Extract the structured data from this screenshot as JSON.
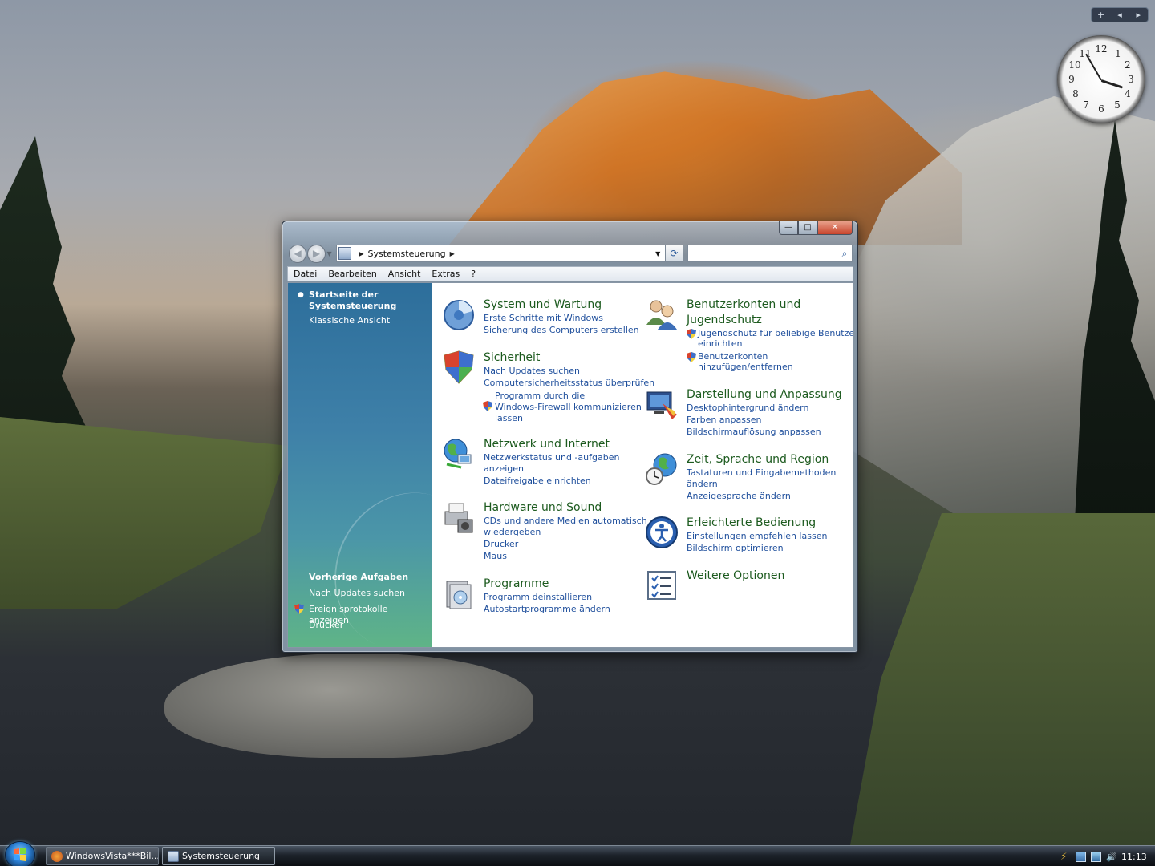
{
  "window": {
    "breadcrumb": "Systemsteuerung",
    "search_placeholder": "",
    "buttons": {
      "minimize": "—",
      "maximize": "□",
      "close": "✕"
    },
    "nav": {
      "back": "◀",
      "forward": "▶",
      "refresh": "⟳",
      "search_icon": "⌕"
    }
  },
  "menu": [
    "Datei",
    "Bearbeiten",
    "Ansicht",
    "Extras",
    "?"
  ],
  "leftpane": {
    "home": "Startseite der Systemsteuerung",
    "classic": "Klassische Ansicht",
    "recent_title": "Vorherige Aufgaben",
    "recent": [
      "Nach Updates suchen",
      "Ereignisprotokolle anzeigen",
      "Drucker"
    ]
  },
  "categories": {
    "system": {
      "title": "System und Wartung",
      "links": [
        "Erste Schritte mit Windows",
        "Sicherung des Computers erstellen"
      ]
    },
    "security": {
      "title": "Sicherheit",
      "links": [
        "Nach Updates suchen",
        "Computersicherheitsstatus überprüfen",
        "Programm durch die",
        "Windows-Firewall kommunizieren",
        "lassen"
      ]
    },
    "network": {
      "title": "Netzwerk und Internet",
      "links": [
        "Netzwerkstatus und -aufgaben",
        "anzeigen",
        "Dateifreigabe einrichten"
      ]
    },
    "hardware": {
      "title": "Hardware und Sound",
      "links": [
        "CDs und andere Medien automatisch",
        "wiedergeben",
        "Drucker",
        "Maus"
      ]
    },
    "programs": {
      "title": "Programme",
      "links": [
        "Programm deinstallieren",
        "Autostartprogramme ändern"
      ]
    },
    "users": {
      "title_1": "Benutzerkonten und",
      "title_2": "Jugendschutz",
      "links": [
        "Jugendschutz für beliebige Benutzer",
        "einrichten",
        "Benutzerkonten",
        "hinzufügen/entfernen"
      ]
    },
    "appearance": {
      "title": "Darstellung und Anpassung",
      "links": [
        "Desktophintergrund ändern",
        "Farben anpassen",
        "Bildschirmauflösung anpassen"
      ]
    },
    "clock": {
      "title": "Zeit, Sprache und Region",
      "links": [
        "Tastaturen und Eingabemethoden",
        "ändern",
        "Anzeigesprache ändern"
      ]
    },
    "ease": {
      "title": "Erleichterte Bedienung",
      "links": [
        "Einstellungen empfehlen lassen",
        "Bildschirm optimieren"
      ]
    },
    "more": {
      "title": "Weitere Optionen"
    }
  },
  "gadgets": {
    "controls": [
      "+",
      "◂",
      "▸"
    ],
    "clock_numbers": [
      "12",
      "1",
      "2",
      "3",
      "4",
      "5",
      "6",
      "7",
      "8",
      "9",
      "10",
      "11"
    ]
  },
  "taskbar": {
    "items": [
      "WindowsVista***Bil...",
      "Systemsteuerung"
    ],
    "time": "11:13"
  },
  "colors": {
    "category_title": "#1c5a1e",
    "link": "#1f4f9c",
    "pane_top": "#2d6e9b",
    "pane_bottom": "#5fb487"
  }
}
